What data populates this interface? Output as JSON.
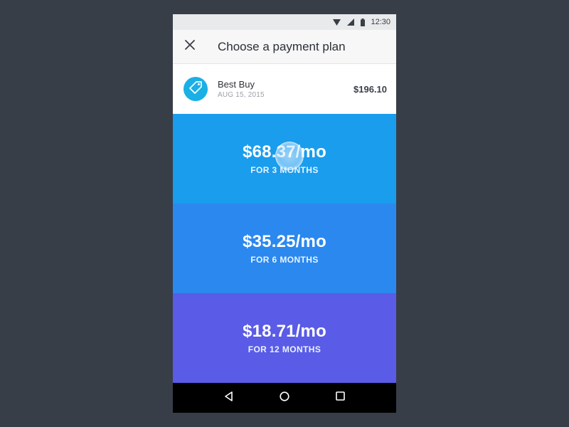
{
  "status_bar": {
    "time": "12:30",
    "icons": [
      "wifi-icon",
      "signal-icon",
      "battery-icon"
    ]
  },
  "app_bar": {
    "title": "Choose a payment plan",
    "close_icon": "close-icon"
  },
  "merchant": {
    "name": "Best Buy",
    "date": "AUG 15, 2015",
    "amount": "$196.10",
    "icon": "price-tag-icon",
    "icon_color": "#1ab0e6"
  },
  "plans": [
    {
      "price": "$68.37/mo",
      "term": "FOR 3 MONTHS",
      "color": "#1a9ded"
    },
    {
      "price": "$35.25/mo",
      "term": "FOR 6 MONTHS",
      "color": "#2b88ef"
    },
    {
      "price": "$18.71/mo",
      "term": "FOR 12 MONTHS",
      "color": "#5a5be6"
    }
  ],
  "nav_bar": {
    "buttons": [
      "back-triangle-icon",
      "home-circle-icon",
      "recents-square-icon"
    ]
  },
  "colors": {
    "background": "#383e48",
    "app_bar": "#f7f7f8"
  }
}
